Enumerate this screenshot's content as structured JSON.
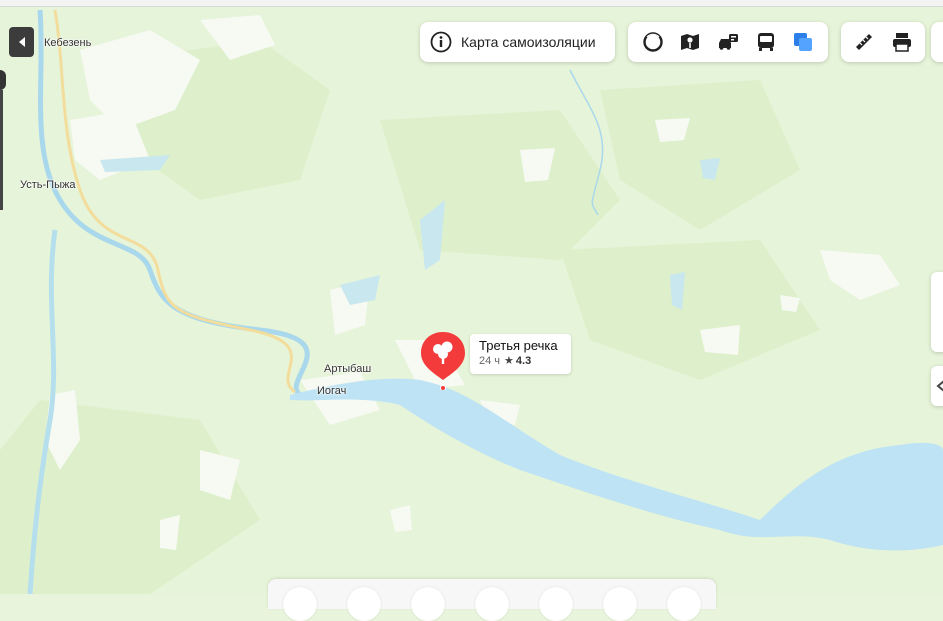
{
  "topbar": {
    "quarantine_button": "Карта самоизоляции"
  },
  "layers": [
    {
      "name": "panorama",
      "icon": "panorama-circle-icon"
    },
    {
      "name": "map-type",
      "icon": "map-book-icon"
    },
    {
      "name": "traffic",
      "icon": "traffic-car-icon"
    },
    {
      "name": "transport",
      "icon": "bus-icon"
    },
    {
      "name": "layers",
      "icon": "layers-icon",
      "active_color": "#3b8bf6"
    }
  ],
  "tools": [
    {
      "name": "ruler",
      "icon": "ruler-icon"
    },
    {
      "name": "print",
      "icon": "printer-icon"
    }
  ],
  "places": {
    "kebezen": "Кебезень",
    "ust_pyzha": "Усть-Пыжа",
    "artybash": "Артыбаш",
    "iogach": "Иогач"
  },
  "poi": {
    "name": "Третья речка",
    "hours": "24 ч",
    "rating": "4.3",
    "pin_color": "#f43b3b"
  },
  "colors": {
    "forest": "#dcf0c9",
    "background": "#e8f5dc",
    "water": "#bde3f4",
    "road": "#f6e2a6"
  }
}
